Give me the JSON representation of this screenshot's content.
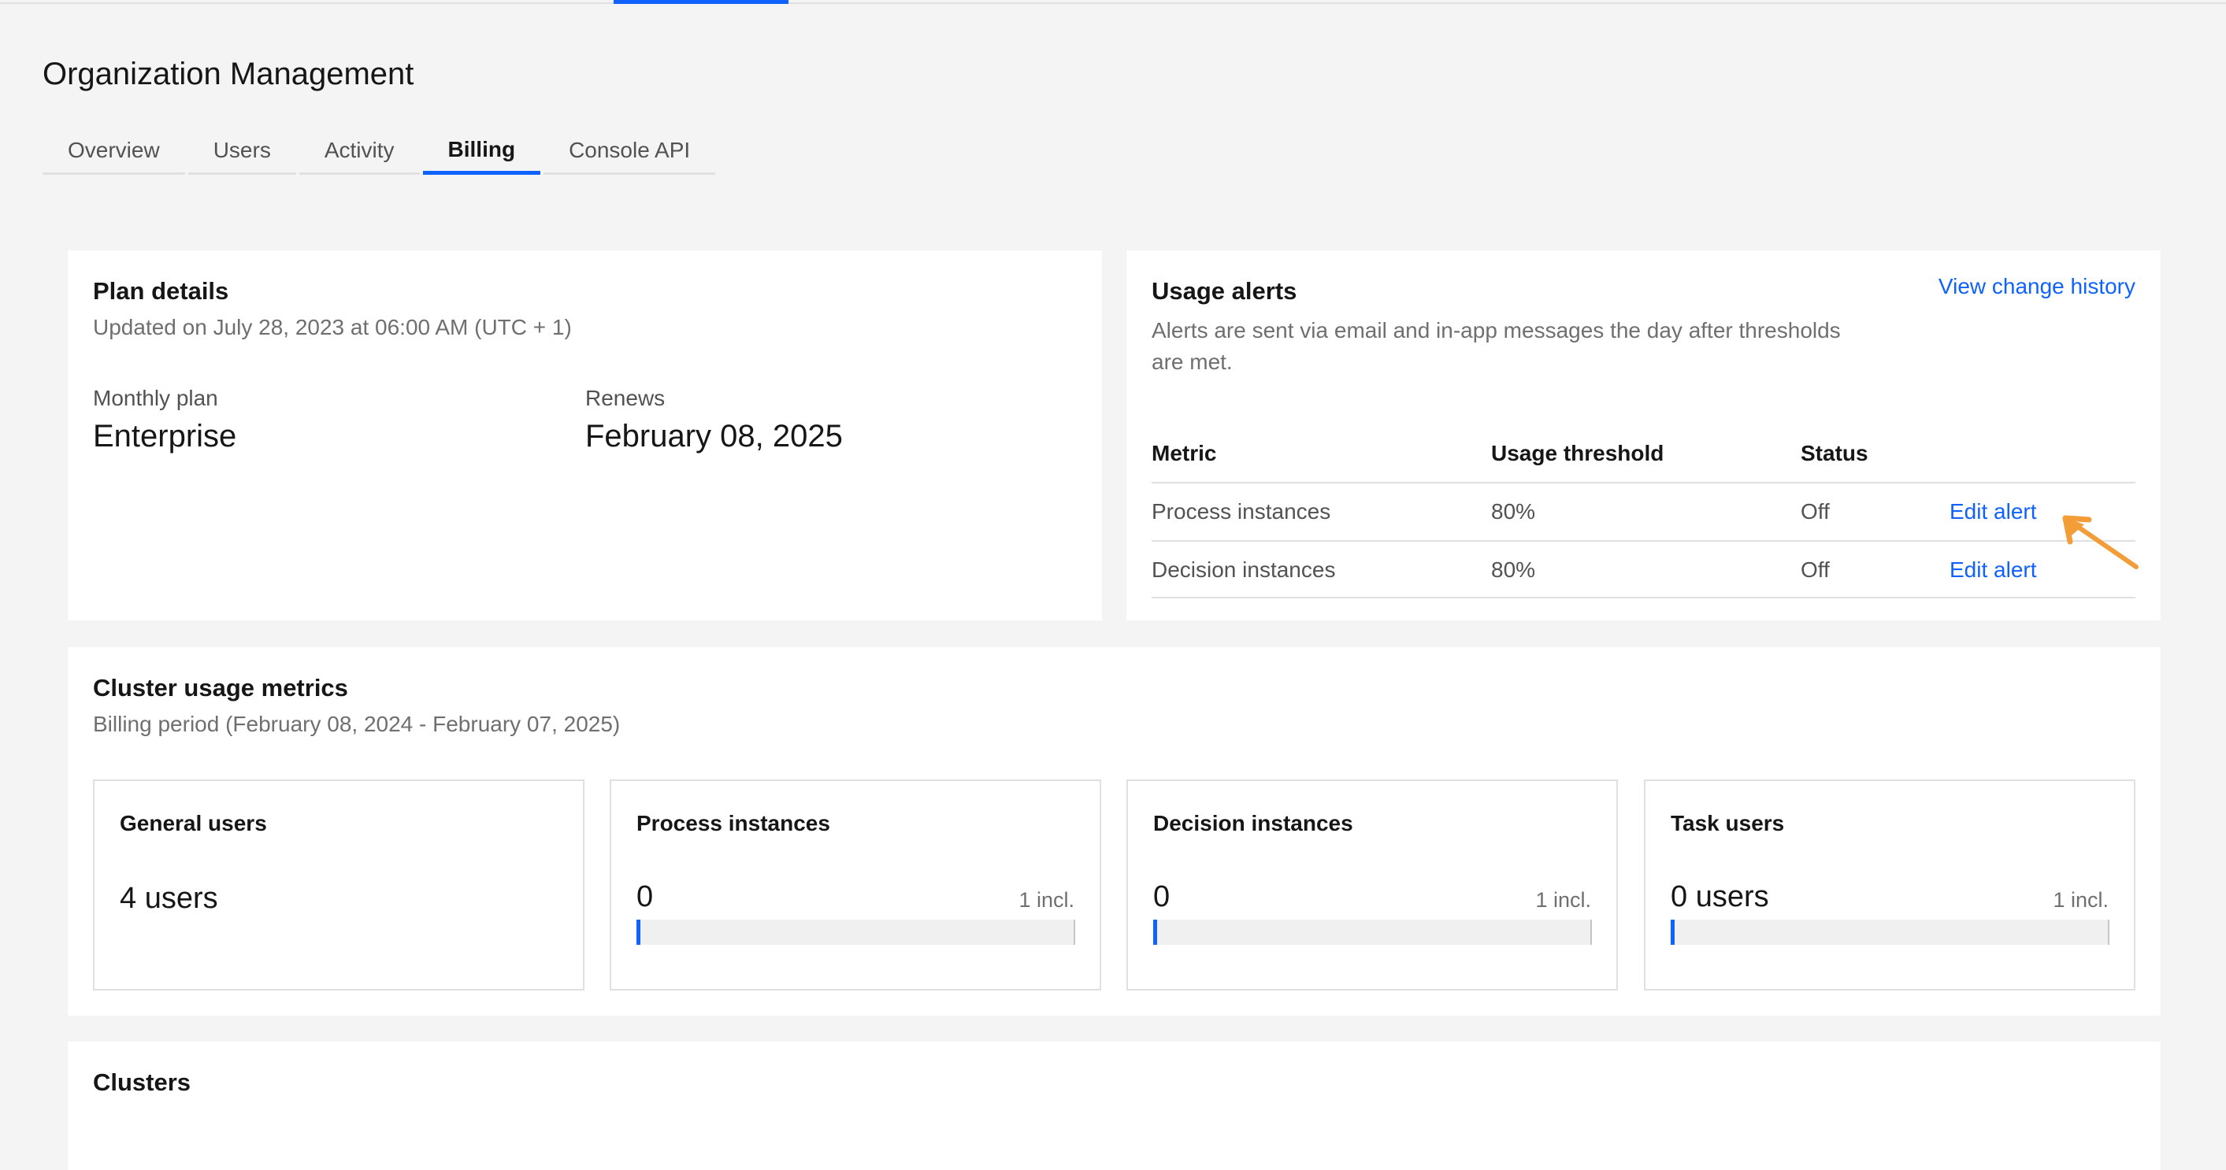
{
  "page": {
    "title": "Organization Management"
  },
  "tabs": [
    {
      "label": "Overview"
    },
    {
      "label": "Users"
    },
    {
      "label": "Activity"
    },
    {
      "label": "Billing",
      "active": true
    },
    {
      "label": "Console API"
    }
  ],
  "plan": {
    "title": "Plan details",
    "updated": "Updated on July 28, 2023 at 06:00 AM (UTC + 1)",
    "monthly_label": "Monthly plan",
    "monthly_value": "Enterprise",
    "renews_label": "Renews",
    "renews_value": "February 08, 2025"
  },
  "alerts": {
    "title": "Usage alerts",
    "history_link": "View change history",
    "description_line1": "Alerts are sent via email and in-app messages the day after thresholds",
    "description_line2": "are met.",
    "columns": [
      "Metric",
      "Usage threshold",
      "Status"
    ],
    "rows": [
      {
        "metric": "Process instances",
        "threshold": "80%",
        "status": "Off",
        "action": "Edit alert"
      },
      {
        "metric": "Decision instances",
        "threshold": "80%",
        "status": "Off",
        "action": "Edit alert"
      }
    ]
  },
  "metrics": {
    "title": "Cluster usage metrics",
    "period": "Billing period (February 08, 2024 - February 07, 2025)",
    "tiles": [
      {
        "title": "General users",
        "value": "4 users",
        "included": "",
        "usage_fraction": null
      },
      {
        "title": "Process instances",
        "value": "0",
        "included": "1 incl.",
        "usage_fraction": 0
      },
      {
        "title": "Decision instances",
        "value": "0",
        "included": "1 incl.",
        "usage_fraction": 0
      },
      {
        "title": "Task users",
        "value": "0 users",
        "included": "1 incl.",
        "usage_fraction": 0
      }
    ]
  },
  "clusters": {
    "title": "Clusters"
  },
  "colors": {
    "accent": "#0f62fe",
    "annotation_arrow": "#f29d38",
    "background": "#f4f4f4"
  },
  "icons": {
    "annotation": "arrow-annotation-icon"
  }
}
